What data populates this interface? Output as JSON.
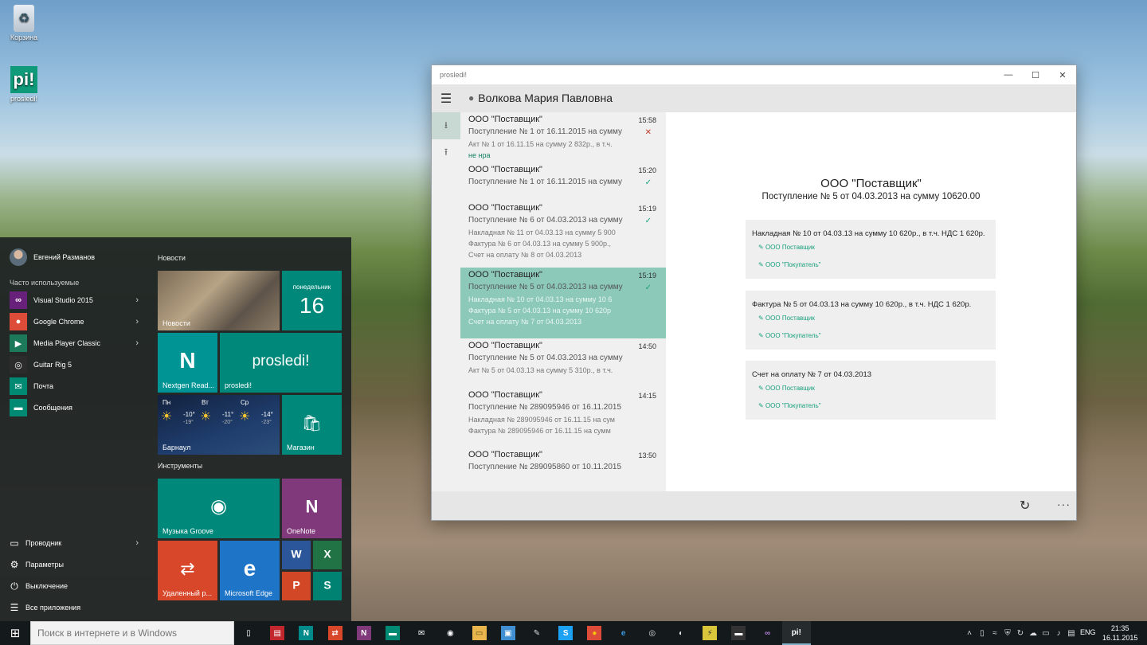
{
  "desktop": {
    "icons": [
      {
        "label": "Корзина",
        "icon": "recycle-bin-icon"
      },
      {
        "label": "prosledi!",
        "icon": "prosledi-app-icon",
        "glyph": "pi!"
      }
    ]
  },
  "start_menu": {
    "user_name": "Евгений Разманов",
    "frequent_heading": "Часто используемые",
    "apps": [
      {
        "label": "Visual Studio 2015",
        "icon": "visual-studio-icon",
        "has_submenu": true,
        "color": "#68217a",
        "glyph": "∞"
      },
      {
        "label": "Google Chrome",
        "icon": "chrome-icon",
        "has_submenu": true,
        "color": "#dd4b39",
        "glyph": "●"
      },
      {
        "label": "Media Player Classic",
        "icon": "media-player-icon",
        "has_submenu": true,
        "color": "#1c7a5a",
        "glyph": "▶"
      },
      {
        "label": "Guitar Rig 5",
        "icon": "guitar-rig-icon",
        "has_submenu": false,
        "color": "#2c2c2c",
        "glyph": "◎"
      },
      {
        "label": "Почта",
        "icon": "mail-icon",
        "has_submenu": false,
        "color": "#008a73",
        "glyph": "✉"
      },
      {
        "label": "Сообщения",
        "icon": "messages-icon",
        "has_submenu": false,
        "color": "#008a73",
        "glyph": "▬"
      }
    ],
    "system": [
      {
        "label": "Проводник",
        "icon": "explorer-icon",
        "glyph": "▭",
        "has_submenu": true
      },
      {
        "label": "Параметры",
        "icon": "settings-icon",
        "glyph": "⚙",
        "has_submenu": false
      },
      {
        "label": "Выключение",
        "icon": "power-icon",
        "glyph": "⏻",
        "has_submenu": false
      },
      {
        "label": "Все приложения",
        "icon": "all-apps-icon",
        "glyph": "☰",
        "has_submenu": false
      }
    ],
    "groups": {
      "news": "Новости",
      "tools": "Инструменты"
    },
    "tiles": {
      "news": "Новости",
      "calendar_day": "понедельник",
      "calendar_date": "16",
      "nextgen": "Nextgen Read...",
      "nextgen_glyph": "N",
      "prosledi_title": "prosledi!",
      "prosledi_label": "prosledi!",
      "weather": {
        "days": [
          {
            "name": "Пн",
            "hi": "-10°",
            "lo": "-19°"
          },
          {
            "name": "Вт",
            "hi": "-11°",
            "lo": "-20°"
          },
          {
            "name": "Ср",
            "hi": "-14°",
            "lo": "-23°"
          }
        ],
        "city": "Барнаул"
      },
      "store": "Магазин",
      "groove": "Музыка Groove",
      "onenote": "OneNote",
      "onenote_glyph": "N",
      "remote": "Удаленный р...",
      "edge": "Microsoft Edge",
      "edge_glyph": "e",
      "word_glyph": "W",
      "excel_glyph": "X",
      "powerpoint_glyph": "P",
      "sway_glyph": "S"
    }
  },
  "window": {
    "title": "prosledi!",
    "user_name": "Волкова Мария Павловна",
    "messages": [
      {
        "org": "ООО \"Поставщик\"",
        "time": "15:58",
        "status": "error",
        "status_glyph": "✕",
        "line1": "Поступление № 1 от 16.11.2015 на сумму",
        "subs": [
          "Акт № 1 от 16.11.15 на сумму 2 832р., в т.ч."
        ],
        "note": "не нра"
      },
      {
        "org": "ООО \"Поставщик\"",
        "time": "15:20",
        "status": "ok",
        "status_glyph": "✓",
        "line1": "Поступление № 1 от 16.11.2015 на сумму",
        "subs": []
      },
      {
        "org": "ООО \"Поставщик\"",
        "time": "15:19",
        "status": "ok",
        "status_glyph": "✓",
        "line1": "Поступление № 6 от 04.03.2013 на сумму",
        "subs": [
          "Накладная № 11 от 04.03.13 на сумму 5 900",
          "Фактура № 6 от 04.03.13 на сумму 5 900р.,",
          "Счет на оплату № 8 от 04.03.2013"
        ]
      },
      {
        "org": "ООО \"Поставщик\"",
        "time": "15:19",
        "status": "ok",
        "status_glyph": "✓",
        "selected": true,
        "line1": "Поступление № 5 от 04.03.2013 на сумму",
        "subs": [
          "Накладная № 10 от 04.03.13 на сумму 10 6",
          "Фактура № 5 от 04.03.13 на сумму 10 620р",
          "Счет на оплату № 7 от 04.03.2013"
        ]
      },
      {
        "org": "ООО \"Поставщик\"",
        "time": "14:50",
        "status": "",
        "line1": "Поступление № 5 от 04.03.2013 на сумму",
        "subs": [
          "Акт № 5 от 04.03.13 на сумму 5 310р., в т.ч."
        ]
      },
      {
        "org": "ООО \"Поставщик\"",
        "time": "14:15",
        "status": "",
        "line1": "Поступление № 289095946 от 16.11.2015",
        "subs": [
          "Накладная № 289095946 от 16.11.15 на сум",
          "Фактура № 289095946 от 16.11.15 на сумм"
        ]
      },
      {
        "org": "ООО \"Поставщик\"",
        "time": "13:50",
        "status": "",
        "line1": "Поступление № 289095860 от 10.11.2015",
        "subs": []
      }
    ],
    "detail": {
      "title": "ООО \"Поставщик\"",
      "subtitle": "Поступление № 5 от 04.03.2013 на сумму 10620.00",
      "documents": [
        {
          "name": "Накладная № 10 от 04.03.13 на сумму 10 620р., в т.ч. НДС 1 620р.",
          "from": "ООО Поставщик",
          "to": "ООО \"Покупатель\""
        },
        {
          "name": "Фактура № 5 от 04.03.13 на сумму 10 620р., в т.ч. НДС 1 620р.",
          "from": "ООО Поставщик",
          "to": "ООО \"Покупатель\""
        },
        {
          "name": "Счет на оплату № 7 от 04.03.2013",
          "from": "ООО Поставщик",
          "to": "ООО \"Покупатель\""
        }
      ]
    }
  },
  "taskbar": {
    "search_placeholder": "Поиск в интернете и в Windows",
    "apps": [
      {
        "icon": "task-view-icon",
        "glyph": "▯",
        "color": "",
        "fg": "#ffffff"
      },
      {
        "icon": "news-app-icon",
        "glyph": "▤",
        "color": "#c1272d",
        "fg": "#ffffff"
      },
      {
        "icon": "nextgen-reader-icon",
        "glyph": "N",
        "color": "#008a8a",
        "fg": "#ffffff"
      },
      {
        "icon": "remote-desktop-icon",
        "glyph": "⇄",
        "color": "#d9472b",
        "fg": "#ffffff"
      },
      {
        "icon": "onenote-icon",
        "glyph": "N",
        "color": "#80397b",
        "fg": "#ffffff"
      },
      {
        "icon": "messages-icon",
        "glyph": "▬",
        "color": "#008a73",
        "fg": "#ffffff"
      },
      {
        "icon": "mail-icon",
        "glyph": "✉",
        "color": "",
        "fg": "#ffffff"
      },
      {
        "icon": "groove-icon",
        "glyph": "◉",
        "color": "",
        "fg": "#ffffff"
      },
      {
        "icon": "file-explorer-icon",
        "glyph": "▭",
        "color": "#e8b64c",
        "fg": "#5a4a1a"
      },
      {
        "icon": "photos-icon",
        "glyph": "▣",
        "color": "#3f8fd2",
        "fg": "#ffffff"
      },
      {
        "icon": "paint-icon",
        "glyph": "✎",
        "color": "",
        "fg": "#dddddd"
      },
      {
        "icon": "skype-icon",
        "glyph": "S",
        "color": "#1da1f2",
        "fg": "#ffffff"
      },
      {
        "icon": "chrome-icon",
        "glyph": "●",
        "color": "#dd4b39",
        "fg": "#f4c20d"
      },
      {
        "icon": "edge-icon",
        "glyph": "e",
        "color": "",
        "fg": "#3b9ae1"
      },
      {
        "icon": "guitar-rig-icon",
        "glyph": "◎",
        "color": "",
        "fg": "#dddddd"
      },
      {
        "icon": "media-player-icon",
        "glyph": "◐",
        "color": "",
        "fg": "#dddddd"
      },
      {
        "icon": "winamp-icon",
        "glyph": "⚡",
        "color": "#d9c63b",
        "fg": "#333333"
      },
      {
        "icon": "terminal-icon",
        "glyph": "▬",
        "color": "#333333",
        "fg": "#ffffff"
      },
      {
        "icon": "visual-studio-icon",
        "glyph": "∞",
        "color": "",
        "fg": "#b180d7"
      },
      {
        "icon": "prosledi-app-icon",
        "glyph": "pi!",
        "color": "",
        "fg": "#ffffff",
        "active": true
      }
    ],
    "tray": [
      {
        "icon": "chevron-up-icon",
        "glyph": "˄"
      },
      {
        "icon": "usb-icon",
        "glyph": "▯"
      },
      {
        "icon": "wifi-icon",
        "glyph": "≈"
      },
      {
        "icon": "antivirus-icon",
        "glyph": "⛨"
      },
      {
        "icon": "sync-icon",
        "glyph": "↻"
      },
      {
        "icon": "cloud-icon",
        "glyph": "☁"
      },
      {
        "icon": "network-icon",
        "glyph": "▭"
      },
      {
        "icon": "volume-icon",
        "glyph": "♪"
      },
      {
        "icon": "notifications-icon",
        "glyph": "▤"
      }
    ],
    "language": "ENG",
    "time": "21:35",
    "date": "16.11.2015"
  }
}
